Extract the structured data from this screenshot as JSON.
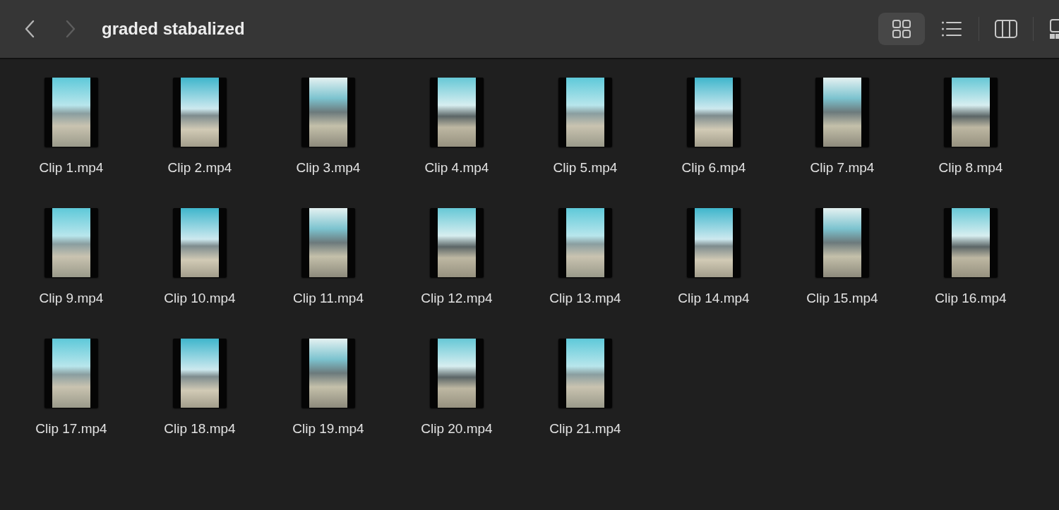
{
  "toolbar": {
    "back": {
      "disabled": false
    },
    "forward": {
      "disabled": true
    },
    "title": "graded stabalized",
    "view_modes": [
      {
        "kind": "icons",
        "selected": true
      },
      {
        "kind": "list",
        "selected": false
      },
      {
        "kind": "columns",
        "selected": false
      },
      {
        "kind": "gallery",
        "selected": false
      }
    ]
  },
  "files": [
    {
      "name": "Clip 1.mp4"
    },
    {
      "name": "Clip 2.mp4"
    },
    {
      "name": "Clip 3.mp4"
    },
    {
      "name": "Clip 4.mp4"
    },
    {
      "name": "Clip 5.mp4"
    },
    {
      "name": "Clip 6.mp4"
    },
    {
      "name": "Clip 7.mp4"
    },
    {
      "name": "Clip 8.mp4"
    },
    {
      "name": "Clip 9.mp4"
    },
    {
      "name": "Clip 10.mp4"
    },
    {
      "name": "Clip 11.mp4"
    },
    {
      "name": "Clip 12.mp4"
    },
    {
      "name": "Clip 13.mp4"
    },
    {
      "name": "Clip 14.mp4"
    },
    {
      "name": "Clip 15.mp4"
    },
    {
      "name": "Clip 16.mp4"
    },
    {
      "name": "Clip 17.mp4"
    },
    {
      "name": "Clip 18.mp4"
    },
    {
      "name": "Clip 19.mp4"
    },
    {
      "name": "Clip 20.mp4"
    },
    {
      "name": "Clip 21.mp4"
    }
  ]
}
